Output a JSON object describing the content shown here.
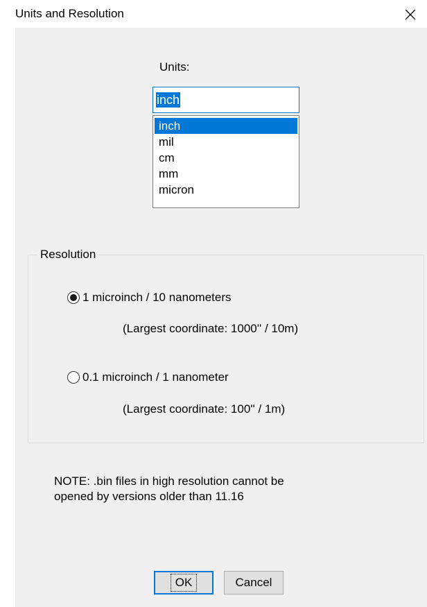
{
  "window": {
    "title": "Units and Resolution",
    "close_icon": "close-icon"
  },
  "units": {
    "label": "Units:",
    "value": "inch",
    "options": [
      "inch",
      "mil",
      "cm",
      "mm",
      "micron"
    ],
    "selected": "inch"
  },
  "resolution": {
    "legend": "Resolution",
    "options": [
      {
        "label": "1 microinch / 10 nanometers",
        "hint": "(Largest coordinate: 1000'' / 10m)",
        "checked": true
      },
      {
        "label": "0.1 microinch / 1 nanometer",
        "hint": "(Largest coordinate: 100'' / 1m)",
        "checked": false
      }
    ]
  },
  "note": {
    "line1": "NOTE: .bin files in high resolution cannot be",
    "line2": "opened by versions older than 11.16"
  },
  "buttons": {
    "ok_label": "OK",
    "cancel_label": "Cancel"
  },
  "colors": {
    "accent": "#0078d7",
    "dialog_bg": "#f0f0f0"
  }
}
